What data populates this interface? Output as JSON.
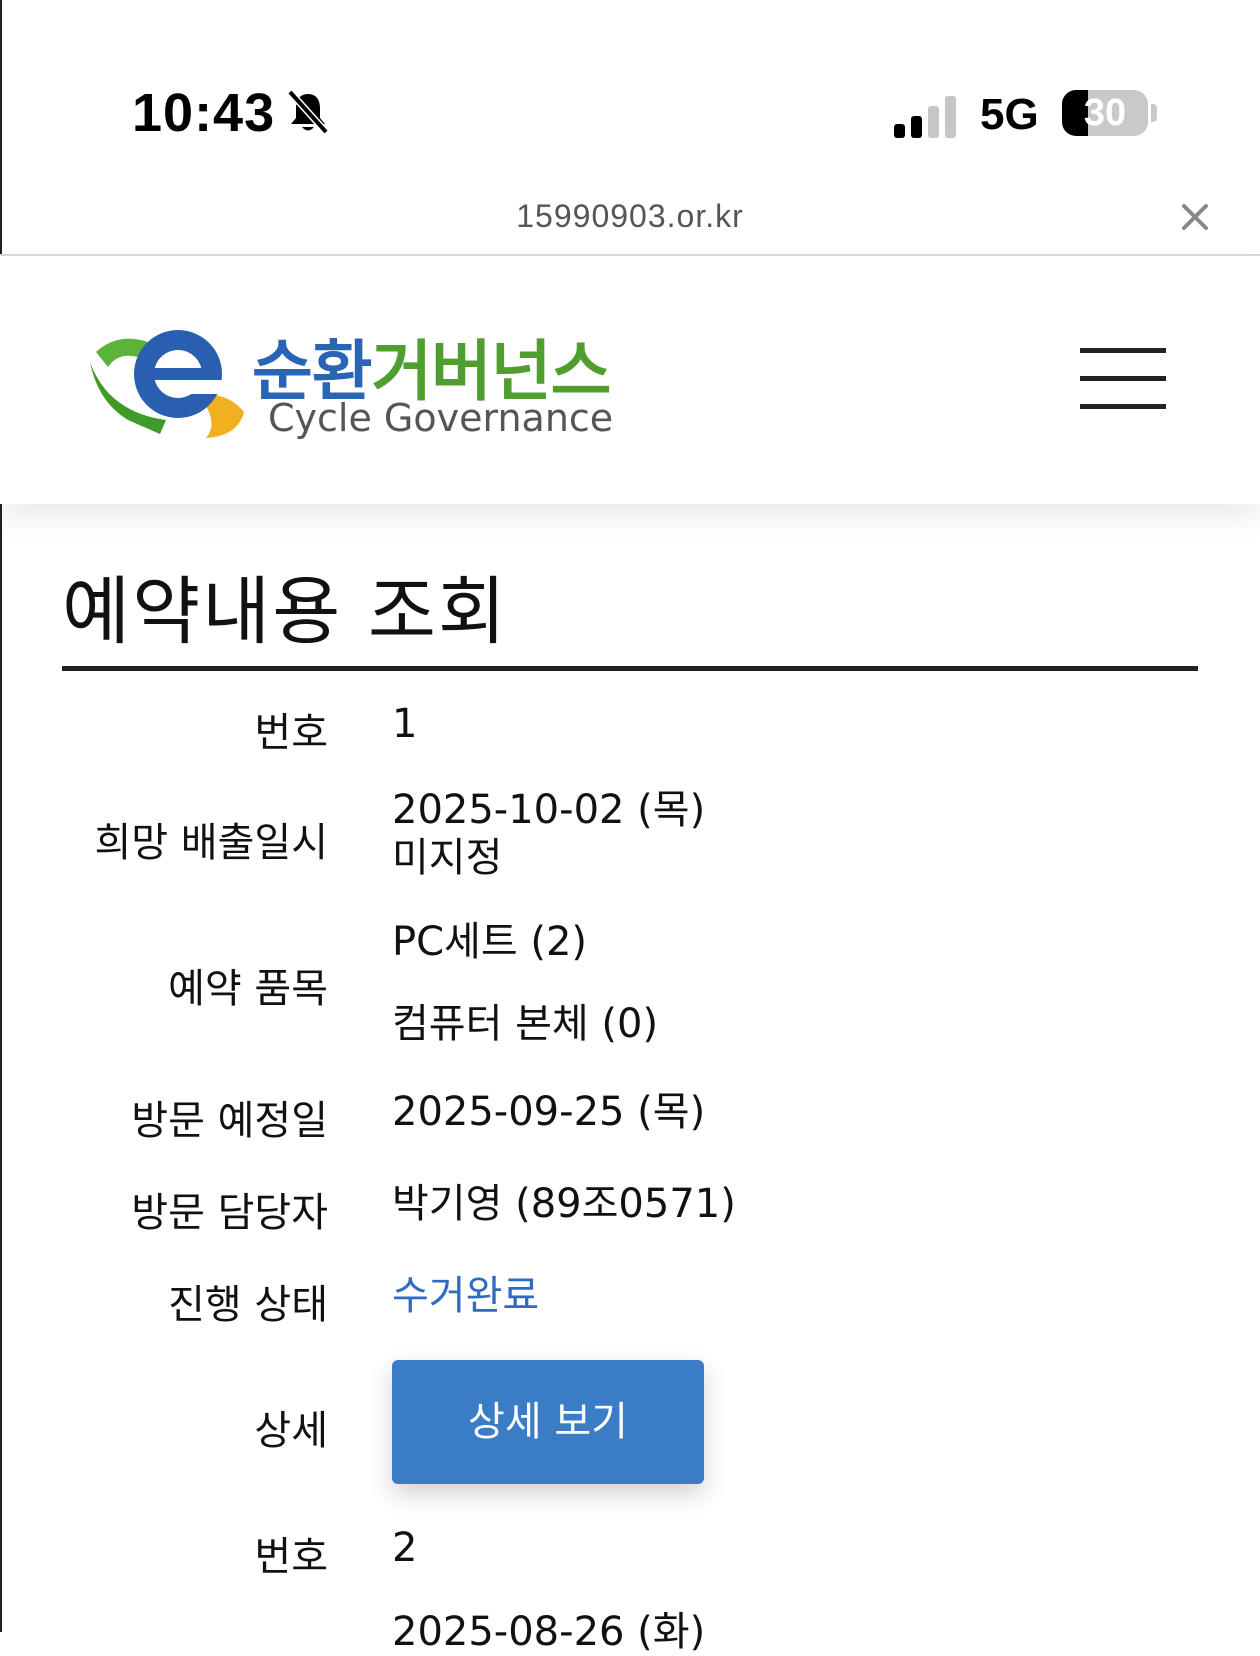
{
  "status_bar": {
    "time": "10:43",
    "network": "5G",
    "battery": "30",
    "battery_level": 0.3
  },
  "browser": {
    "url": "15990903.or.kr"
  },
  "header": {
    "logo_ko_blue": "순환",
    "logo_ko_green": "거버넌스",
    "logo_en": "Cycle Governance"
  },
  "page": {
    "title": "예약내용 조회"
  },
  "reservation_1": {
    "number_label": "번호",
    "number": "1",
    "desired_date_label": "희망 배출일시",
    "desired_date": "2025-10-02 (목)",
    "desired_time": "미지정",
    "items_label": "예약 품목",
    "item_1": "PC세트 (2)",
    "item_2": "컴퓨터 본체 (0)",
    "visit_date_label": "방문 예정일",
    "visit_date": "2025-09-25 (목)",
    "visitor_label": "방문 담당자",
    "visitor": "박기영 (89조0571)",
    "status_label": "진행 상태",
    "status": "수거완료",
    "detail_label": "상세",
    "detail_button": "상세 보기"
  },
  "reservation_2": {
    "number_label": "번호",
    "number": "2",
    "desired_date": "2025-08-26 (화)"
  },
  "colors": {
    "status_blue": "#2f6bbf",
    "button_blue": "#3b7cc7",
    "logo_blue": "#2a64b4",
    "logo_green": "#4f9e2f"
  }
}
